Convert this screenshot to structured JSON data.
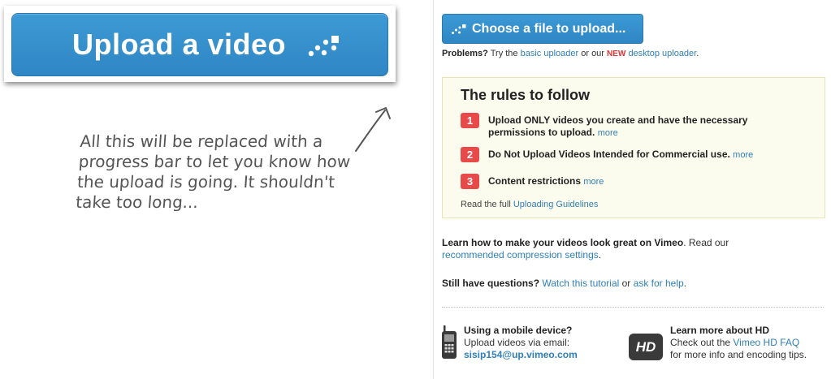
{
  "upload_button": {
    "label": "Upload a video",
    "icon": "upload-dots-icon"
  },
  "note": {
    "lines": [
      "All this will be replaced with a",
      "progress bar to let you know how",
      "the upload is going. It shouldn't",
      "take too long..."
    ]
  },
  "choose_button": {
    "label": "Choose a file to upload...",
    "icon": "upload-dots-icon"
  },
  "problems": {
    "lead": "Problems?",
    "text1": " Try the ",
    "basic_link": "basic uploader",
    "text2": " or our ",
    "new_badge": "NEW",
    "desktop_link": "desktop uploader",
    "text3": "."
  },
  "rules": {
    "title": "The rules to follow",
    "items": [
      {
        "num": "1",
        "text": "Upload ONLY videos you create and have the necessary permissions to upload.",
        "more": "more"
      },
      {
        "num": "2",
        "text": "Do Not Upload Videos Intended for Commercial use.",
        "more": "more"
      },
      {
        "num": "3",
        "text": "Content restrictions",
        "more": "more"
      }
    ],
    "footer_text": "Read the full ",
    "footer_link": "Uploading Guidelines"
  },
  "learn": {
    "bold": "Learn how to make your videos look great on Vimeo",
    "text": ". Read our",
    "link": "recommended compression settings",
    "end": "."
  },
  "questions": {
    "bold": "Still have questions?",
    "link1": "Watch this tutorial",
    "mid": " or ",
    "link2": "ask for help",
    "end": "."
  },
  "mobile": {
    "title": "Using a mobile device?",
    "text": "Upload videos via email:",
    "email": "sisip154@up.vimeo.com",
    "icon": "mobile-phone-icon"
  },
  "hd": {
    "badge": "HD",
    "title": "Learn more about HD",
    "text1": "Check out the ",
    "link": "Vimeo HD FAQ",
    "text2": "for more info and encoding tips."
  },
  "colors": {
    "button_blue": "#3591cf",
    "link_blue": "#2f7fb7",
    "rule_red": "#e84a4a",
    "rules_bg": "#fcfcee"
  }
}
